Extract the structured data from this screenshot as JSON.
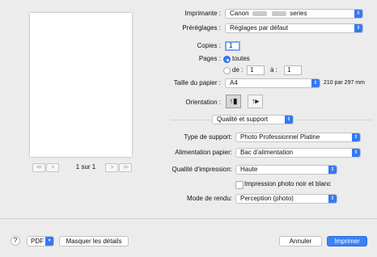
{
  "preview": {
    "page_indicator": "1 sur 1"
  },
  "printer": {
    "label": "Imprimante :",
    "value_prefix": "Canon",
    "value_suffix": "series"
  },
  "presets": {
    "label": "Préréglages :",
    "value": "Réglages par défaut"
  },
  "copies": {
    "label": "Copies :",
    "value": "1"
  },
  "pages": {
    "label": "Pages :",
    "all_label": "toutes",
    "from_label": "de :",
    "from_value": "1",
    "to_label": "à :",
    "to_value": "1"
  },
  "paper_size": {
    "label": "Taille du papier :",
    "value": "A4",
    "dimensions": "210 par 297 mm"
  },
  "orientation": {
    "label": "Orientation :"
  },
  "section": {
    "value": "Qualité et support"
  },
  "media_type": {
    "label": "Type de support:",
    "value": "Photo Professionnel Platine"
  },
  "paper_source": {
    "label": "Alimentation papier:",
    "value": "Bac d'alimentation"
  },
  "print_quality": {
    "label": "Qualité d'impression:",
    "value": "Haute"
  },
  "grayscale": {
    "label": "Impression photo noir et blanc"
  },
  "render_mode": {
    "label": "Mode de rendu:",
    "value": "Perception (photo)"
  },
  "footer": {
    "help": "?",
    "pdf": "PDF",
    "hide_details": "Masquer les détails",
    "cancel": "Annuler",
    "print": "Imprimer"
  },
  "colors": {
    "accent": "#3478f6",
    "background": "#ececec"
  }
}
